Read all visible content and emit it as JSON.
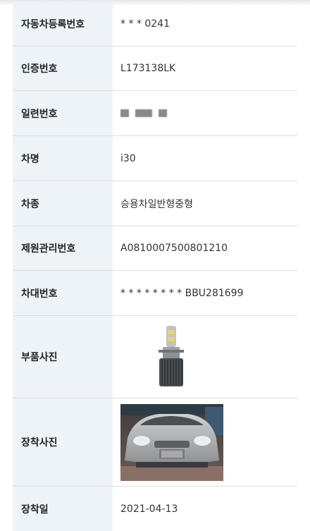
{
  "rows": [
    {
      "label": "자동차등록번호",
      "value": "* * * 0241"
    },
    {
      "label": "인증번호",
      "value": "L173138LK"
    },
    {
      "label": "일련번호",
      "value": ""
    },
    {
      "label": "차명",
      "value": "i30"
    },
    {
      "label": "차종",
      "value": "승용차일반형중형"
    },
    {
      "label": "제원관리번호",
      "value": "A0810007500801210"
    },
    {
      "label": "차대번호",
      "value": "* * * * * * * * BBU281699"
    },
    {
      "label": "부품사진",
      "value": ""
    },
    {
      "label": "장착사진",
      "value": ""
    },
    {
      "label": "장착일",
      "value": "2021-04-13"
    }
  ],
  "colors": {
    "label_bg": "#eef3f8",
    "divider": "#dedede"
  },
  "icons": {
    "part": "led-headlight-bulb",
    "car": "car-front-photo"
  }
}
